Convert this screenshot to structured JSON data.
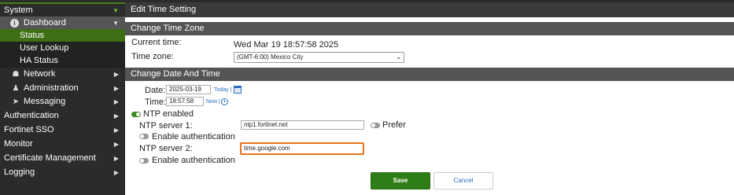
{
  "sidebar": {
    "system": "System",
    "dashboard": "Dashboard",
    "sub_items": [
      "Status",
      "User Lookup",
      "HA Status"
    ],
    "items": [
      {
        "label": "Network",
        "icon": "network-icon"
      },
      {
        "label": "Administration",
        "icon": "admin-icon"
      },
      {
        "label": "Messaging",
        "icon": "messaging-icon"
      }
    ],
    "top_items": [
      "Authentication",
      "Fortinet SSO",
      "Monitor",
      "Certificate Management",
      "Logging"
    ]
  },
  "page": {
    "title": "Edit Time Setting"
  },
  "time_zone": {
    "section_title": "Change Time Zone",
    "current_time_label": "Current time:",
    "current_time_value": "Wed Mar 19 18:57:58 2025",
    "time_zone_label": "Time zone:",
    "time_zone_value": "(GMT-6:00) Mexico City"
  },
  "date_time": {
    "section_title": "Change Date And Time",
    "date_label": "Date:",
    "date_value": "2025-03-19",
    "today_link": "Today |",
    "time_label": "Time:",
    "time_value": "18:57:58",
    "now_link": "Now |",
    "ntp_enabled_label": "NTP enabled",
    "ntp_server1_label": "NTP server 1:",
    "ntp_server1_value": "ntp1.fortinet.net",
    "prefer_label": "Prefer",
    "enable_auth_label": "Enable authentication",
    "ntp_server2_label": "NTP server 2:",
    "ntp_server2_value": "time.google.com",
    "enable_auth2_label": "Enable authentication"
  },
  "buttons": {
    "save": "Save",
    "cancel": "Cancel"
  },
  "colors": {
    "accent_green": "#2e7d16",
    "focus_orange": "#e8731c",
    "link_blue": "#2a6ebb"
  }
}
